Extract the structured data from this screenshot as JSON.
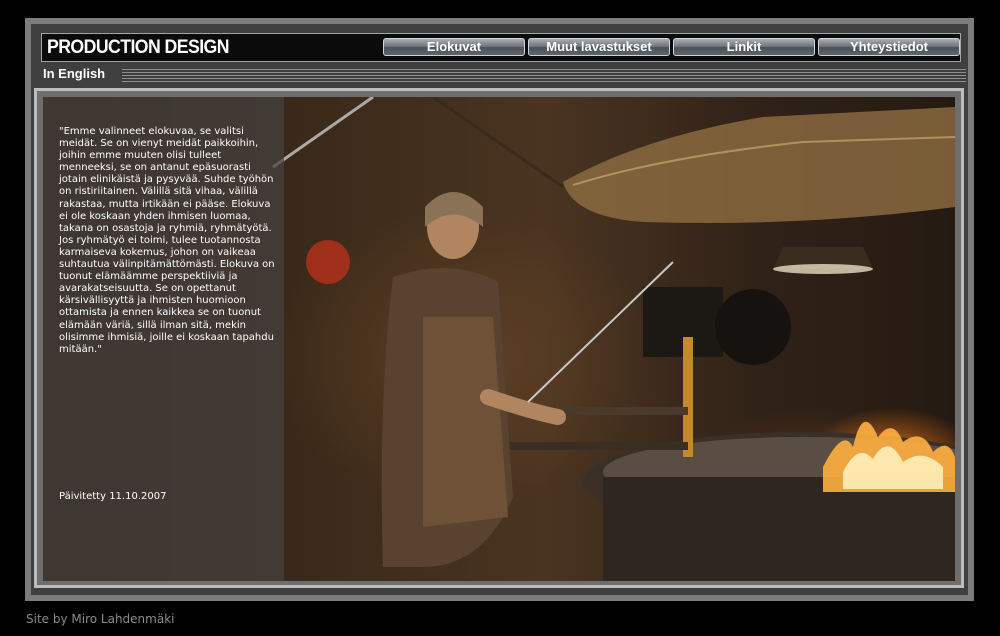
{
  "header": {
    "logo": "PRODUCTION DESIGN",
    "nav": [
      {
        "label": "Elokuvat"
      },
      {
        "label": "Muut lavastukset"
      },
      {
        "label": "Linkit"
      },
      {
        "label": "Yhteystiedot"
      }
    ],
    "language_link": "In English"
  },
  "content": {
    "quote": "\"Emme valinneet elokuvaa, se valitsi meidät. Se on vienyt meidät paikkoihin, joihin emme muuten olisi tulleet menneeksi, se on antanut epäsuorasti jotain elinikäistä ja pysyvää. Suhde työhön on ristiriitainen. Välillä sitä vihaa, välillä rakastaa, mutta irtikään ei pääse. Elokuva ei ole koskaan yhden ihmisen luomaa, takana on osastoja ja ryhmiä, ryhmätyötä. Jos ryhmätyö ei toimi, tulee tuotannosta karmaiseva kokemus, johon on vaikeaa suhtautua välinpitämättömästi. Elokuva on tuonut elämäämme perspektiiviä ja avarakatseisuutta. Se on opettanut kärsivällisyyttä ja ihmisten huomioon ottamista ja ennen kaikkea se on tuonut elämään väriä, sillä ilman sitä, mekin olisimme ihmisiä, joille ei koskaan tapahdu mitään.\"",
    "updated": "Päivitetty 11.10.2007"
  },
  "footer": {
    "credit": "Site by Miro Lahdenmäki"
  }
}
